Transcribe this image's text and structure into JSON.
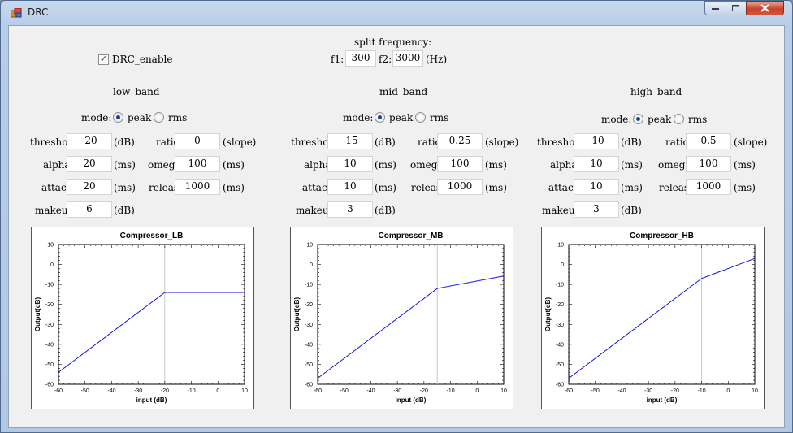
{
  "window": {
    "title": "DRC"
  },
  "drc_enable": {
    "label": "DRC_enable",
    "checked": true
  },
  "split": {
    "title": "split frequency:",
    "f1_label": "f1:",
    "f1_value": "300",
    "f2_label": "f2:",
    "f2_value": "3000",
    "unit": "(Hz)"
  },
  "labels": {
    "mode": "mode:",
    "peak": "peak",
    "rms": "rms",
    "threshold": "threshold",
    "ratio": "ratio",
    "alpha": "alpha",
    "omega": "omega",
    "attack": "attack",
    "release": "release",
    "makeup": "makeup",
    "db": "(dB)",
    "ms": "(ms)",
    "slope": "(slope)"
  },
  "bands": [
    {
      "name": "low_band",
      "mode": "peak",
      "threshold": "-20",
      "ratio": "0",
      "alpha": "20",
      "omega": "100",
      "attack": "20",
      "release": "1000",
      "makeup": "6"
    },
    {
      "name": "mid_band",
      "mode": "peak",
      "threshold": "-15",
      "ratio": "0.25",
      "alpha": "10",
      "omega": "100",
      "attack": "10",
      "release": "1000",
      "makeup": "3"
    },
    {
      "name": "high_band",
      "mode": "peak",
      "threshold": "-10",
      "ratio": "0.5",
      "alpha": "10",
      "omega": "100",
      "attack": "10",
      "release": "1000",
      "makeup": "3"
    }
  ],
  "chart_data": [
    {
      "type": "line",
      "title": "Compressor_LB",
      "xlabel": "input (dB)",
      "ylabel": "Output(dB)",
      "xlim": [
        -60,
        10
      ],
      "ylim": [
        -60,
        10
      ],
      "xticks": [
        -60,
        -50,
        -40,
        -30,
        -20,
        -10,
        0,
        10
      ],
      "yticks": [
        10,
        0,
        -10,
        -20,
        -30,
        -40,
        -50,
        -60
      ],
      "threshold": -20,
      "series": [
        {
          "x": [
            -60,
            -20,
            10
          ],
          "y": [
            -54,
            -14,
            -14
          ]
        }
      ]
    },
    {
      "type": "line",
      "title": "Compressor_MB",
      "xlabel": "input (dB)",
      "ylabel": "Output(dB)",
      "xlim": [
        -60,
        10
      ],
      "ylim": [
        -60,
        10
      ],
      "xticks": [
        -60,
        -50,
        -40,
        -30,
        -20,
        -10,
        0,
        10
      ],
      "yticks": [
        10,
        0,
        -10,
        -20,
        -30,
        -40,
        -50,
        -60
      ],
      "threshold": -15,
      "series": [
        {
          "x": [
            -60,
            -15,
            10
          ],
          "y": [
            -57,
            -12,
            -5.75
          ]
        }
      ]
    },
    {
      "type": "line",
      "title": "Compressor_HB",
      "xlabel": "input (dB)",
      "ylabel": "Output(dB)",
      "xlim": [
        -60,
        10
      ],
      "ylim": [
        -60,
        10
      ],
      "xticks": [
        -60,
        -50,
        -40,
        -30,
        -20,
        -10,
        0,
        10
      ],
      "yticks": [
        10,
        0,
        -10,
        -20,
        -30,
        -40,
        -50,
        -60
      ],
      "threshold": -10,
      "series": [
        {
          "x": [
            -60,
            -10,
            10
          ],
          "y": [
            -57,
            -7,
            3
          ]
        }
      ]
    }
  ]
}
